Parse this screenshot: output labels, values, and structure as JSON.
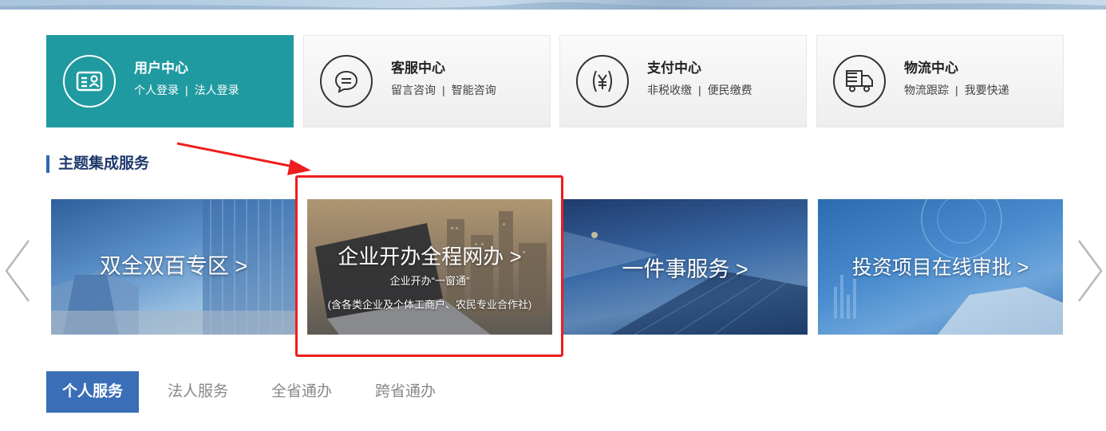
{
  "service_cards": [
    {
      "title": "用户中心",
      "links": [
        "个人登录",
        "法人登录"
      ],
      "icon": "id-card-icon",
      "active": true
    },
    {
      "title": "客服中心",
      "links": [
        "留言咨询",
        "智能咨询"
      ],
      "icon": "chat-bubble-icon",
      "active": false
    },
    {
      "title": "支付中心",
      "links": [
        "非税收缴",
        "便民缴费"
      ],
      "icon": "yuan-icon",
      "active": false
    },
    {
      "title": "物流中心",
      "links": [
        "物流跟踪",
        "我要快递"
      ],
      "icon": "truck-icon",
      "active": false
    }
  ],
  "section": {
    "title": "主题集成服务"
  },
  "carousel": {
    "tiles": [
      {
        "label": "双全双百专区 >"
      },
      {
        "label": "企业开办全程网办 >",
        "sub1": "企业开办“一窗通”",
        "sub2": "(含各类企业及个体工商户、农民专业合作社)"
      },
      {
        "label": "一件事服务 >"
      },
      {
        "label": "投资项目在线审批 >"
      }
    ]
  },
  "tabs": [
    {
      "label": "个人服务",
      "active": true
    },
    {
      "label": "法人服务",
      "active": false
    },
    {
      "label": "全省通办",
      "active": false
    },
    {
      "label": "跨省通办",
      "active": false
    }
  ],
  "colors": {
    "accent_teal": "#1f9aa0",
    "tab_blue": "#3a6fb8",
    "highlight_red": "#ee1e1e",
    "section_blue": "#2b67b6"
  }
}
